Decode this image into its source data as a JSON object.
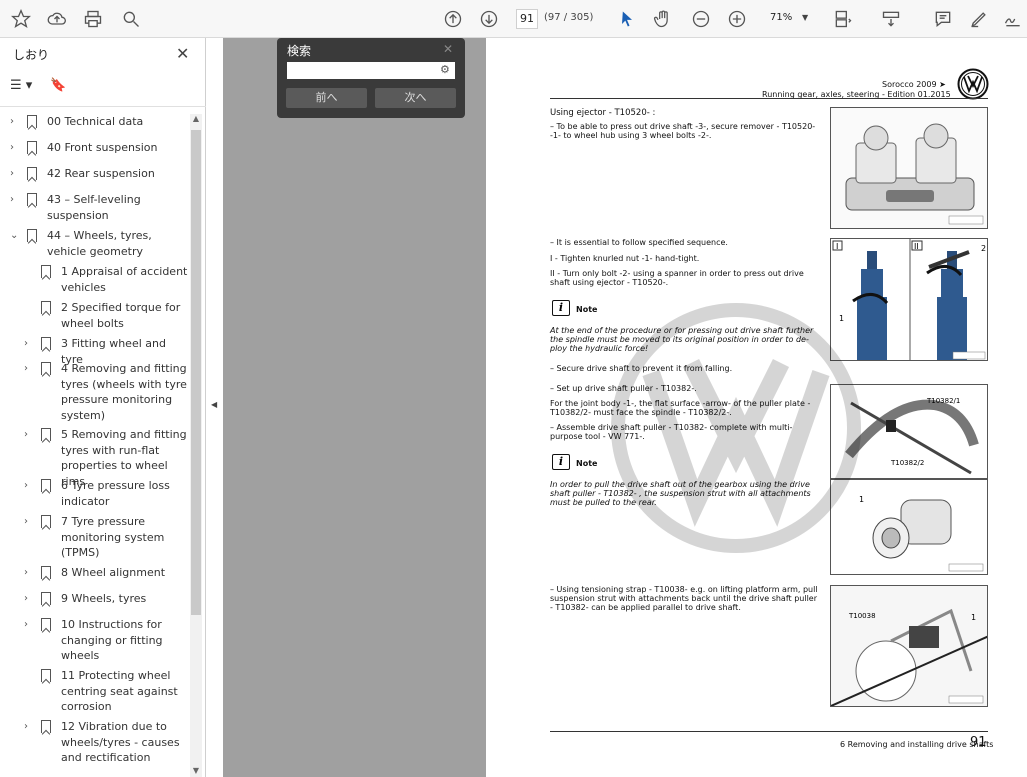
{
  "toolbar": {
    "page_current": "91",
    "page_total": "(97 / 305)",
    "zoom": "71%"
  },
  "sidebar": {
    "title": "しおり",
    "items": [
      {
        "label": "00 Technical data",
        "expand": true
      },
      {
        "label": "40 Front suspension",
        "expand": true
      },
      {
        "label": "42 Rear suspension",
        "expand": true
      },
      {
        "label": "43 – Self-leveling suspension",
        "expand": true
      },
      {
        "label": "44 – Wheels, tyres, vehicle geometry",
        "expand": true,
        "open": true
      },
      {
        "label": "1 Appraisal of accident vehicles",
        "expand": false
      },
      {
        "label": "2 Specified torque for wheel bolts",
        "expand": false
      },
      {
        "label": "3 Fitting wheel and tyre",
        "expand": true
      },
      {
        "label": "4 Removing and fitting tyres (wheels with tyre pressure monitoring system)",
        "expand": true
      },
      {
        "label": "5 Removing and fitting tyres with run-flat properties to wheel rims",
        "expand": true
      },
      {
        "label": "6 Tyre pressure loss indicator",
        "expand": true
      },
      {
        "label": "7 Tyre pressure monitoring system (TPMS)",
        "expand": true
      },
      {
        "label": "8 Wheel alignment",
        "expand": true
      },
      {
        "label": "9 Wheels, tyres",
        "expand": true
      },
      {
        "label": "10 Instructions for changing or fitting wheels",
        "expand": true
      },
      {
        "label": "11 Protecting wheel centring seat against corrosion",
        "expand": false
      },
      {
        "label": "12 Vibration due to wheels/tyres - causes and rectification",
        "expand": true
      }
    ]
  },
  "search": {
    "title": "検索",
    "prev": "前へ",
    "next": "次へ"
  },
  "pdf": {
    "header_model": "Sorocco 2009 ➤",
    "header_section": "Running gear, axles, steering - Edition 01.2015",
    "p1": "Using ejector - T10520- :",
    "p2": "– To be able to press out drive shaft -3-, secure remover - T10520- -1- to wheel hub using 3 wheel bolts -2-.",
    "p3": "– It is essential to follow specified sequence.",
    "p4": "I - Tighten knurled nut -1- hand-tight.",
    "p5": "II - Turn only bolt -2- using a spanner in order to press out drive shaft using ejector - T10520-.",
    "note1_label": "Note",
    "note1": "At the end of the procedure or for pressing out drive shaft further the spindle must be moved to its original position in order to de-ploy the hydraulic force!",
    "p6": "– Secure drive shaft to prevent it from falling.",
    "p7": "– Set up drive shaft puller - T10382-.",
    "p8": "For the joint body -1-, the flat surface -arrow- of the puller plate - T10382/2- must face the spindle - T10382/2-.",
    "p9": "– Assemble drive shaft puller - T10382- complete with multi-purpose tool - VW 771-.",
    "note2_label": "Note",
    "note2": "In order to pull the drive shaft out of the gearbox using the drive shaft puller - T10382- , the suspension strut with all attachments must be pulled to the rear.",
    "p10": "– Using tensioning strap - T10038- e.g. on lifting platform arm, pull suspension strut with attachments back until the drive shaft puller - T10382- can be applied parallel to drive shaft.",
    "fig_label_a": "T10382/1",
    "fig_label_b": "T10382/2",
    "fig_label_c": "T10038",
    "footer_title": "6 Removing and installing drive shafts",
    "footer_page": "91"
  }
}
